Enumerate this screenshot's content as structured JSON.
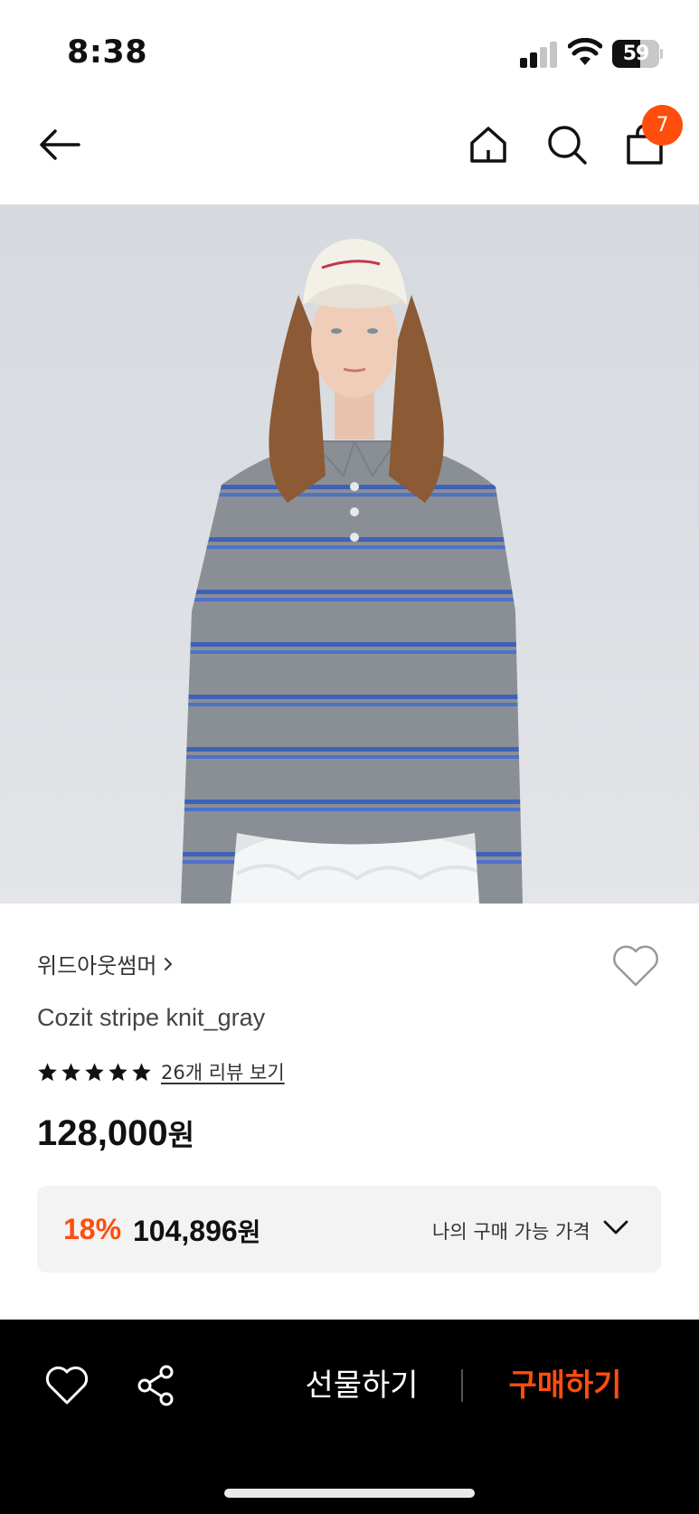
{
  "status_bar": {
    "time": "8:38",
    "battery_level": "59",
    "battery_fraction": 0.59,
    "icons": [
      "cellular-signal-icon",
      "wifi-icon",
      "battery-icon"
    ]
  },
  "nav": {
    "icons": [
      "back-arrow-icon",
      "home-icon",
      "search-icon",
      "shopping-bag-icon"
    ],
    "cart_count": "7",
    "badge_color": "#ff4d0d"
  },
  "product": {
    "brand": "위드아웃썸머",
    "name": "Cozit stripe knit_gray",
    "rating_stars": 5,
    "review_link": "26개 리뷰 보기",
    "price_number": "128,000",
    "price_unit": "원"
  },
  "my_price": {
    "discount_rate": "18%",
    "discounted_number": "104,896",
    "discounted_unit": "원",
    "label": "나의 구매 가능 가격"
  },
  "bottom_bar": {
    "gift_label": "선물하기",
    "buy_label": "구매하기",
    "accent_color": "#ff4d0d",
    "icons": [
      "heart-icon",
      "share-icon"
    ]
  }
}
